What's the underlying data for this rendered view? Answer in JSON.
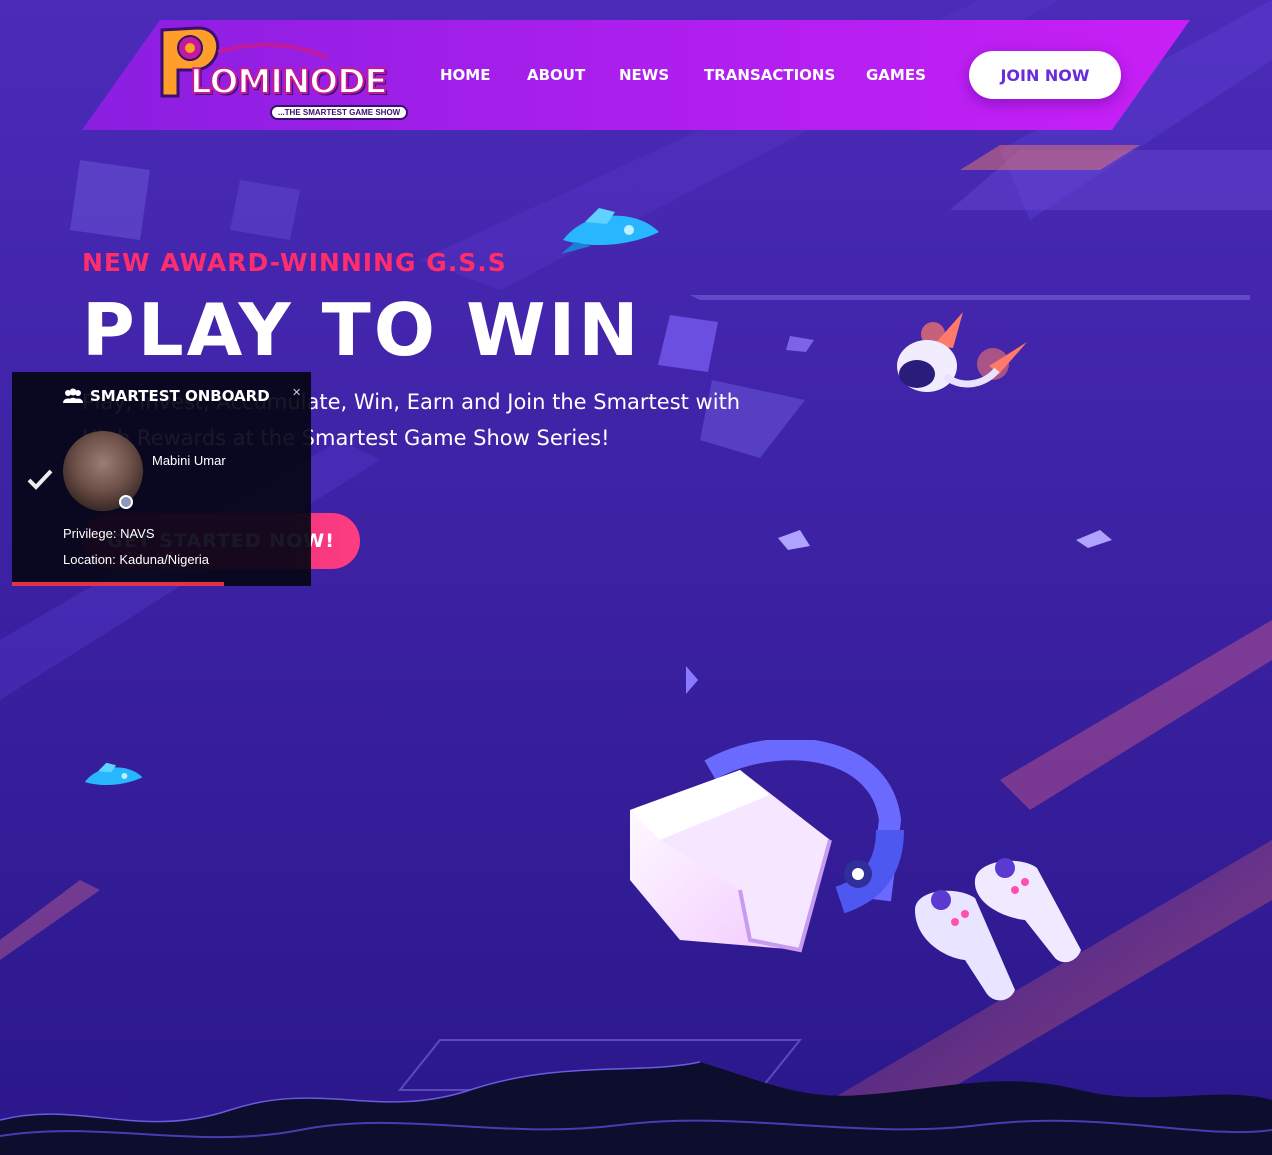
{
  "brand": {
    "logo_word": "LOMINODE",
    "tagline": "...THE SMARTEST GAME SHOW"
  },
  "nav": {
    "items": [
      "HOME",
      "ABOUT",
      "NEWS",
      "TRANSACTIONS",
      "GAMES"
    ],
    "join_label": "JOIN NOW"
  },
  "hero": {
    "kicker": "NEW AWARD-WINNING G.S.S",
    "title": "PLAY TO WIN",
    "subtitle": "Play, Invest, Accumulate, Win, Earn and Join the Smartest with High Rewards at the Smartest Game Show Series!",
    "cta_label": "GET STARTED NOW!"
  },
  "notification": {
    "title": "SMARTEST ONBOARD",
    "close_symbol": "✕",
    "name": "Mabini Umar",
    "privilege": "Privilege: NAVS",
    "location": "Location: Kaduna/Nigeria",
    "progress": 0.71
  },
  "colors": {
    "background": "#3b22a3",
    "header": "#b21ff0",
    "accent": "#ff2d6b",
    "cta": "#ff3d7f"
  },
  "icons": [
    "users-icon",
    "close-icon",
    "check-icon",
    "spaceship-icon",
    "astronaut-icon",
    "vr-headset-icon",
    "gamepad-icon"
  ]
}
